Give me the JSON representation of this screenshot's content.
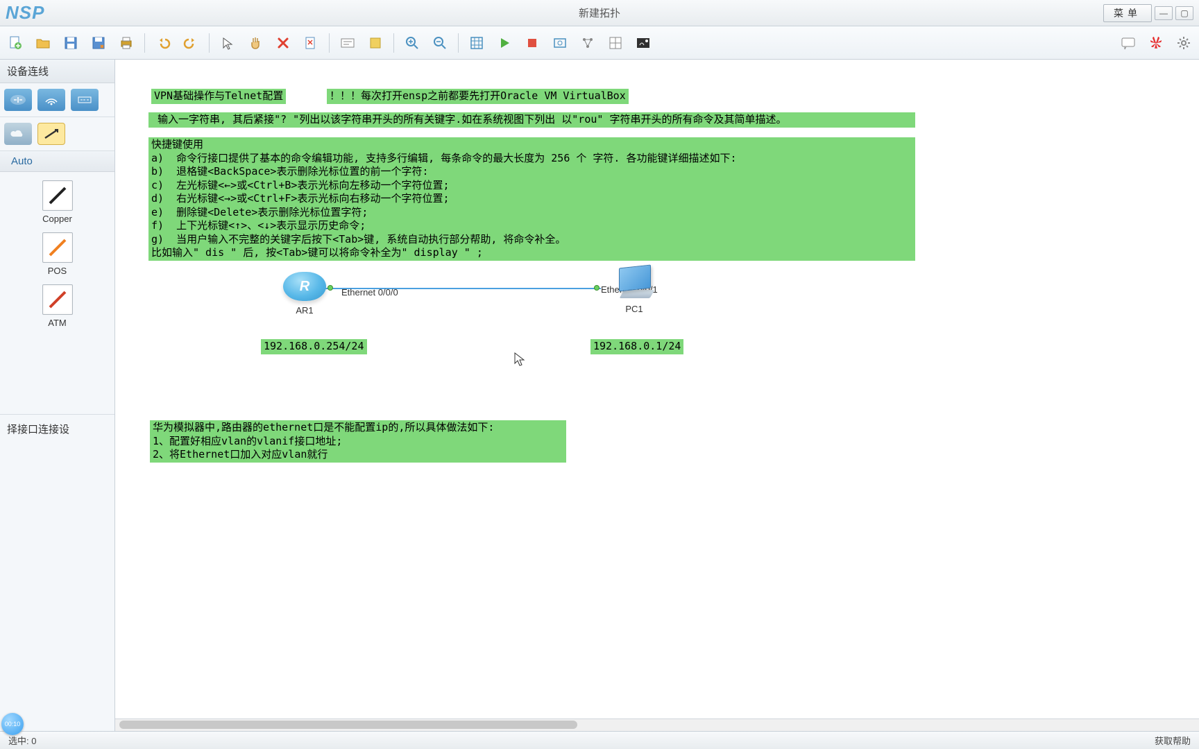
{
  "app": {
    "logo": "NSP",
    "title": "新建拓扑",
    "menu_label": "菜单"
  },
  "sidebar": {
    "header": "设备连线",
    "mode": "Auto",
    "links": [
      {
        "label": "Copper",
        "color": "#222"
      },
      {
        "label": "POS",
        "color": "#f08020"
      },
      {
        "label": "ATM",
        "color": "#d04028"
      }
    ],
    "desc": "择接口连接设"
  },
  "notes": {
    "n1": "VPN基础操作与Telnet配置",
    "n2": "！！！每次打开ensp之前都要先打开Oracle VM VirtualBox",
    "n3_line1": " 输入一字符串, 其后紧接\"? \"列出以该字符串开头的所有关键字.如在系统视图下列出 以\"rou\" 字符串开头的所有命令及其简单描述。",
    "n3_body": "快捷键使用\na)  命令行接口提供了基本的命令编辑功能, 支持多行编辑, 每条命令的最大长度为 256 个 字符. 各功能键详细描述如下:\nb)  退格键<BackSpace>表示删除光标位置的前一个字符:\nc)  左光标键<←>或<Ctrl+B>表示光标向左移动一个字符位置;\nd)  右光标键<→>或<Ctrl+F>表示光标向右移动一个字符位置;\ne)  删除键<Delete>表示删除光标位置字符;\nf)  上下光标键<↑>、<↓>表示显示历史命令;\ng)  当用户输入不完整的关键字后按下<Tab>键, 系统自动执行部分帮助, 将命令补全。\n比如输入\" dis \" 后, 按<Tab>键可以将命令补全为\" display \" ;",
    "ip1": "192.168.0.254/24",
    "ip2": "192.168.0.1/24",
    "n4": "华为模拟器中,路由器的ethernet口是不能配置ip的,所以具体做法如下:\n1、配置好相应vlan的vlanif接口地址;\n2、将Ethernet口加入对应vlan就行"
  },
  "topology": {
    "router": {
      "name": "AR1"
    },
    "pc": {
      "name": "PC1"
    },
    "port_left": "Ethernet 0/0/0",
    "port_right": "Ethernet 0/0/1"
  },
  "status": {
    "left": "选中: 0",
    "right": "获取帮助"
  },
  "timer": "00:10"
}
